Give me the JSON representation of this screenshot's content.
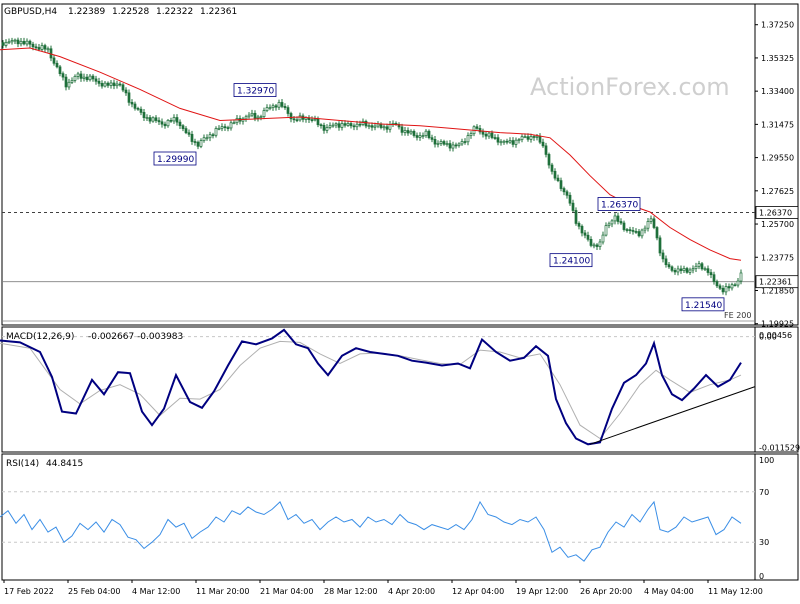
{
  "instrument": "GBPUSD,H4",
  "ohlc_header": [
    "1.22389",
    "1.22528",
    "1.22322",
    "1.22361"
  ],
  "watermark": "ActionForex.com",
  "colors": {
    "candles": "#1f6f3a",
    "sma": "#e01414",
    "macd_line": "#000080",
    "macd_signal": "#b0b0b0",
    "rsi": "#3a8ee6",
    "grid_dash": "#c8c8c8",
    "axis": "#000000"
  },
  "chart_data": [
    {
      "type": "candlestick",
      "pane": "price",
      "ylim": [
        1.1985,
        1.3845
      ],
      "y_ticks": [
        "1.37250",
        "1.35325",
        "1.33400",
        "1.31475",
        "1.29550",
        "1.27625",
        "1.25700",
        "1.23775",
        "1.21850",
        "1.19925"
      ],
      "x_tick_labels": [
        "17 Feb 2022",
        "25 Feb 04:00",
        "4 Mar 12:00",
        "11 Mar 20:00",
        "21 Mar 04:00",
        "28 Mar 12:00",
        "4 Apr 20:00",
        "12 Apr 04:00",
        "19 Apr 12:00",
        "26 Apr 20:00",
        "4 May 04:00",
        "11 May 12:00"
      ],
      "close_path": [
        [
          0,
          1.362
        ],
        [
          20,
          1.363
        ],
        [
          34,
          1.36
        ],
        [
          48,
          1.358
        ],
        [
          58,
          1.346
        ],
        [
          66,
          1.338
        ],
        [
          78,
          1.343
        ],
        [
          92,
          1.341
        ],
        [
          106,
          1.337
        ],
        [
          118,
          1.339
        ],
        [
          130,
          1.328
        ],
        [
          142,
          1.32
        ],
        [
          154,
          1.317
        ],
        [
          164,
          1.315
        ],
        [
          176,
          1.318
        ],
        [
          188,
          1.308
        ],
        [
          198,
          1.303
        ],
        [
          208,
          1.308
        ],
        [
          218,
          1.312
        ],
        [
          228,
          1.314
        ],
        [
          238,
          1.317
        ],
        [
          248,
          1.32
        ],
        [
          258,
          1.319
        ],
        [
          268,
          1.324
        ],
        [
          278,
          1.327
        ],
        [
          286,
          1.323
        ],
        [
          294,
          1.317
        ],
        [
          306,
          1.319
        ],
        [
          316,
          1.316
        ],
        [
          326,
          1.312
        ],
        [
          336,
          1.315
        ],
        [
          348,
          1.314
        ],
        [
          360,
          1.315
        ],
        [
          372,
          1.314
        ],
        [
          384,
          1.313
        ],
        [
          394,
          1.315
        ],
        [
          404,
          1.311
        ],
        [
          416,
          1.308
        ],
        [
          426,
          1.309
        ],
        [
          436,
          1.304
        ],
        [
          448,
          1.303
        ],
        [
          458,
          1.302
        ],
        [
          468,
          1.308
        ],
        [
          476,
          1.313
        ],
        [
          484,
          1.309
        ],
        [
          494,
          1.307
        ],
        [
          504,
          1.304
        ],
        [
          514,
          1.305
        ],
        [
          524,
          1.307
        ],
        [
          534,
          1.308
        ],
        [
          544,
          1.302
        ],
        [
          552,
          1.286
        ],
        [
          560,
          1.28
        ],
        [
          568,
          1.272
        ],
        [
          576,
          1.259
        ],
        [
          584,
          1.25
        ],
        [
          592,
          1.245
        ],
        [
          600,
          1.245
        ],
        [
          606,
          1.256
        ],
        [
          614,
          1.261
        ],
        [
          622,
          1.256
        ],
        [
          630,
          1.253
        ],
        [
          638,
          1.251
        ],
        [
          646,
          1.256
        ],
        [
          652,
          1.26
        ],
        [
          658,
          1.247
        ],
        [
          662,
          1.236
        ],
        [
          668,
          1.232
        ],
        [
          676,
          1.23
        ],
        [
          684,
          1.23
        ],
        [
          692,
          1.231
        ],
        [
          700,
          1.233
        ],
        [
          708,
          1.23
        ],
        [
          714,
          1.223
        ],
        [
          722,
          1.219
        ],
        [
          730,
          1.22
        ],
        [
          736,
          1.223
        ],
        [
          741,
          1.228
        ]
      ],
      "sma_path": [
        [
          0,
          1.358
        ],
        [
          30,
          1.359
        ],
        [
          60,
          1.354
        ],
        [
          100,
          1.345
        ],
        [
          140,
          1.335
        ],
        [
          180,
          1.324
        ],
        [
          220,
          1.317
        ],
        [
          260,
          1.318
        ],
        [
          300,
          1.319
        ],
        [
          340,
          1.317
        ],
        [
          380,
          1.315
        ],
        [
          420,
          1.314
        ],
        [
          460,
          1.312
        ],
        [
          500,
          1.31
        ],
        [
          530,
          1.309
        ],
        [
          550,
          1.307
        ],
        [
          570,
          1.297
        ],
        [
          590,
          1.285
        ],
        [
          610,
          1.274
        ],
        [
          630,
          1.268
        ],
        [
          650,
          1.264
        ],
        [
          670,
          1.255
        ],
        [
          690,
          1.248
        ],
        [
          710,
          1.242
        ],
        [
          730,
          1.237
        ],
        [
          741,
          1.236
        ]
      ],
      "swing_labels": [
        {
          "text": "1.32970",
          "x": 280,
          "y": 1.3297
        },
        {
          "text": "1.29990",
          "x": 200,
          "y": 1.2999
        },
        {
          "text": "1.26370",
          "x": 640,
          "y": 1.2637
        },
        {
          "text": "1.24100",
          "x": 596,
          "y": 1.241
        },
        {
          "text": "1.21540",
          "x": 722,
          "y": 1.2154
        }
      ],
      "level_lines": [
        {
          "value": 1.2637,
          "style": "dashed",
          "label": "1.26370"
        },
        {
          "value": 1.2236,
          "style": "solid",
          "label": "1.22361"
        },
        {
          "value": 1.2008,
          "style": "solid",
          "label": "FE 200"
        }
      ],
      "last_price": "1.22361"
    },
    {
      "type": "line",
      "pane": "macd",
      "title": "MACD(12,26,9)",
      "values_text": "-0.002667 -0.003983",
      "ylim": [
        -0.012,
        0.001
      ],
      "y_ticks": [
        "0.00456",
        "0.00",
        "-0.011529"
      ],
      "macd_path": [
        [
          0,
          -0.0004
        ],
        [
          20,
          -0.0006
        ],
        [
          40,
          -0.0016
        ],
        [
          52,
          -0.0042
        ],
        [
          62,
          -0.0078
        ],
        [
          76,
          -0.008
        ],
        [
          92,
          -0.0045
        ],
        [
          104,
          -0.006
        ],
        [
          118,
          -0.0037
        ],
        [
          130,
          -0.0038
        ],
        [
          142,
          -0.0078
        ],
        [
          152,
          -0.0092
        ],
        [
          164,
          -0.0075
        ],
        [
          176,
          -0.004
        ],
        [
          190,
          -0.0068
        ],
        [
          202,
          -0.0074
        ],
        [
          214,
          -0.0057
        ],
        [
          228,
          -0.003
        ],
        [
          242,
          -0.0005
        ],
        [
          256,
          -0.0008
        ],
        [
          272,
          -0.0002
        ],
        [
          284,
          0.0007
        ],
        [
          296,
          -0.0008
        ],
        [
          308,
          -0.0012
        ],
        [
          318,
          -0.0028
        ],
        [
          328,
          -0.004
        ],
        [
          342,
          -0.002
        ],
        [
          356,
          -0.0012
        ],
        [
          370,
          -0.0016
        ],
        [
          384,
          -0.0018
        ],
        [
          398,
          -0.002
        ],
        [
          412,
          -0.0025
        ],
        [
          426,
          -0.0027
        ],
        [
          442,
          -0.003
        ],
        [
          458,
          -0.0028
        ],
        [
          470,
          -0.0033
        ],
        [
          482,
          -0.0003
        ],
        [
          496,
          -0.0016
        ],
        [
          510,
          -0.0025
        ],
        [
          524,
          -0.0022
        ],
        [
          536,
          -0.001
        ],
        [
          548,
          -0.002
        ],
        [
          556,
          -0.0065
        ],
        [
          566,
          -0.009
        ],
        [
          576,
          -0.0106
        ],
        [
          588,
          -0.0112
        ],
        [
          600,
          -0.011
        ],
        [
          612,
          -0.0075
        ],
        [
          624,
          -0.0048
        ],
        [
          636,
          -0.004
        ],
        [
          646,
          -0.0028
        ],
        [
          654,
          -0.0007
        ],
        [
          662,
          -0.004
        ],
        [
          672,
          -0.006
        ],
        [
          682,
          -0.0066
        ],
        [
          694,
          -0.0054
        ],
        [
          706,
          -0.004
        ],
        [
          718,
          -0.0052
        ],
        [
          730,
          -0.0045
        ],
        [
          741,
          -0.0027
        ]
      ],
      "signal_path": [
        [
          0,
          -0.0007
        ],
        [
          30,
          -0.0012
        ],
        [
          60,
          -0.0055
        ],
        [
          80,
          -0.007
        ],
        [
          100,
          -0.0056
        ],
        [
          120,
          -0.005
        ],
        [
          140,
          -0.006
        ],
        [
          160,
          -0.0082
        ],
        [
          180,
          -0.0064
        ],
        [
          200,
          -0.0065
        ],
        [
          220,
          -0.0055
        ],
        [
          240,
          -0.003
        ],
        [
          260,
          -0.0012
        ],
        [
          280,
          -0.0005
        ],
        [
          300,
          -0.0006
        ],
        [
          320,
          -0.0018
        ],
        [
          340,
          -0.0028
        ],
        [
          360,
          -0.0018
        ],
        [
          380,
          -0.0017
        ],
        [
          400,
          -0.002
        ],
        [
          420,
          -0.0024
        ],
        [
          440,
          -0.0028
        ],
        [
          460,
          -0.0029
        ],
        [
          480,
          -0.0014
        ],
        [
          500,
          -0.0016
        ],
        [
          520,
          -0.0022
        ],
        [
          540,
          -0.0018
        ],
        [
          560,
          -0.005
        ],
        [
          580,
          -0.0092
        ],
        [
          600,
          -0.0106
        ],
        [
          620,
          -0.008
        ],
        [
          640,
          -0.005
        ],
        [
          656,
          -0.0035
        ],
        [
          670,
          -0.0045
        ],
        [
          690,
          -0.0058
        ],
        [
          710,
          -0.005
        ],
        [
          730,
          -0.0045
        ],
        [
          741,
          -0.004
        ]
      ],
      "trendline": [
        [
          590,
          -0.0112
        ],
        [
          755,
          -0.0052
        ]
      ]
    },
    {
      "type": "line",
      "pane": "rsi",
      "title": "RSI(14)",
      "values_text": "44.8415",
      "ylim": [
        0,
        100
      ],
      "y_ticks": [
        "100",
        "70",
        "30",
        "0"
      ],
      "levels": [
        70,
        30
      ],
      "rsi_path": [
        [
          0,
          50
        ],
        [
          8,
          55
        ],
        [
          16,
          45
        ],
        [
          24,
          52
        ],
        [
          32,
          40
        ],
        [
          40,
          48
        ],
        [
          48,
          38
        ],
        [
          56,
          42
        ],
        [
          64,
          30
        ],
        [
          72,
          35
        ],
        [
          80,
          45
        ],
        [
          88,
          40
        ],
        [
          96,
          46
        ],
        [
          104,
          38
        ],
        [
          112,
          48
        ],
        [
          120,
          44
        ],
        [
          128,
          34
        ],
        [
          136,
          32
        ],
        [
          144,
          25
        ],
        [
          152,
          30
        ],
        [
          160,
          36
        ],
        [
          168,
          48
        ],
        [
          176,
          42
        ],
        [
          184,
          45
        ],
        [
          192,
          33
        ],
        [
          200,
          38
        ],
        [
          208,
          42
        ],
        [
          216,
          50
        ],
        [
          224,
          46
        ],
        [
          232,
          55
        ],
        [
          240,
          52
        ],
        [
          248,
          58
        ],
        [
          256,
          54
        ],
        [
          264,
          52
        ],
        [
          272,
          56
        ],
        [
          280,
          62
        ],
        [
          288,
          48
        ],
        [
          296,
          52
        ],
        [
          304,
          45
        ],
        [
          312,
          48
        ],
        [
          320,
          40
        ],
        [
          328,
          46
        ],
        [
          336,
          50
        ],
        [
          344,
          46
        ],
        [
          352,
          48
        ],
        [
          360,
          42
        ],
        [
          368,
          50
        ],
        [
          376,
          46
        ],
        [
          384,
          48
        ],
        [
          392,
          44
        ],
        [
          400,
          52
        ],
        [
          408,
          46
        ],
        [
          416,
          44
        ],
        [
          424,
          40
        ],
        [
          432,
          44
        ],
        [
          440,
          42
        ],
        [
          448,
          40
        ],
        [
          456,
          44
        ],
        [
          464,
          40
        ],
        [
          472,
          48
        ],
        [
          480,
          62
        ],
        [
          488,
          52
        ],
        [
          496,
          50
        ],
        [
          504,
          46
        ],
        [
          512,
          44
        ],
        [
          520,
          48
        ],
        [
          528,
          46
        ],
        [
          536,
          50
        ],
        [
          544,
          40
        ],
        [
          552,
          22
        ],
        [
          560,
          26
        ],
        [
          568,
          18
        ],
        [
          576,
          20
        ],
        [
          584,
          15
        ],
        [
          592,
          24
        ],
        [
          600,
          26
        ],
        [
          608,
          38
        ],
        [
          616,
          46
        ],
        [
          624,
          42
        ],
        [
          632,
          52
        ],
        [
          640,
          46
        ],
        [
          648,
          56
        ],
        [
          654,
          62
        ],
        [
          660,
          40
        ],
        [
          668,
          38
        ],
        [
          676,
          42
        ],
        [
          684,
          50
        ],
        [
          692,
          46
        ],
        [
          700,
          48
        ],
        [
          708,
          50
        ],
        [
          716,
          36
        ],
        [
          724,
          40
        ],
        [
          732,
          50
        ],
        [
          741,
          45
        ]
      ]
    }
  ]
}
